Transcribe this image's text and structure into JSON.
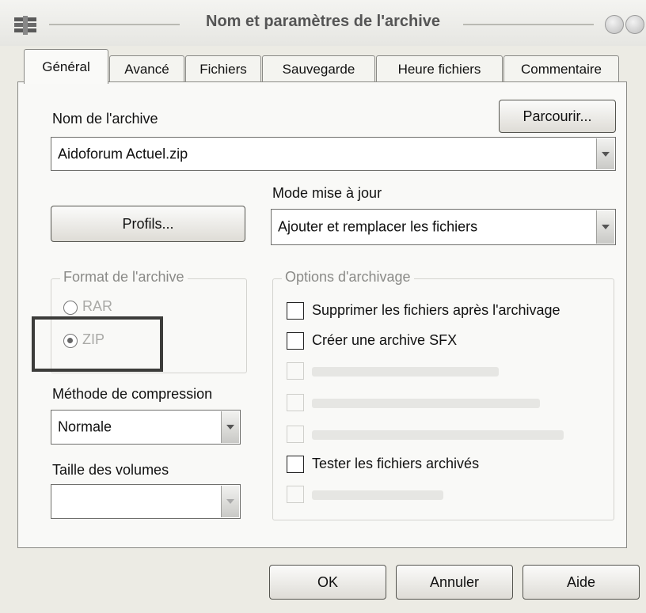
{
  "window": {
    "title": "Nom et paramètres de l'archive"
  },
  "tabs": [
    "Général",
    "Avancé",
    "Fichiers",
    "Sauvegarde",
    "Heure fichiers",
    "Commentaire"
  ],
  "general": {
    "archive_name_label": "Nom de l'archive",
    "browse_button": "Parcourir...",
    "archive_name_value": "Aidoforum Actuel.zip",
    "update_mode_label": "Mode mise à jour",
    "update_mode_value": "Ajouter et remplacer les fichiers",
    "profiles_button": "Profils...",
    "format_group_title": "Format de l'archive",
    "format_options": [
      "RAR",
      "ZIP"
    ],
    "format_selected": "ZIP",
    "compression_label": "Méthode de compression",
    "compression_value": "Normale",
    "volume_size_label": "Taille des volumes",
    "volume_size_value": "",
    "options_group_title": "Options d'archivage",
    "options": [
      {
        "label": "Supprimer les fichiers après l'archivage",
        "checked": false,
        "enabled": true
      },
      {
        "label": "Créer une archive SFX",
        "checked": false,
        "enabled": true
      },
      {
        "label": "",
        "checked": false,
        "enabled": false
      },
      {
        "label": "",
        "checked": false,
        "enabled": false
      },
      {
        "label": "",
        "checked": false,
        "enabled": false
      },
      {
        "label": "Tester les fichiers archivés",
        "checked": false,
        "enabled": true
      },
      {
        "label": "",
        "checked": false,
        "enabled": false
      }
    ]
  },
  "buttons": {
    "ok": "OK",
    "cancel": "Annuler",
    "help": "Aide"
  }
}
